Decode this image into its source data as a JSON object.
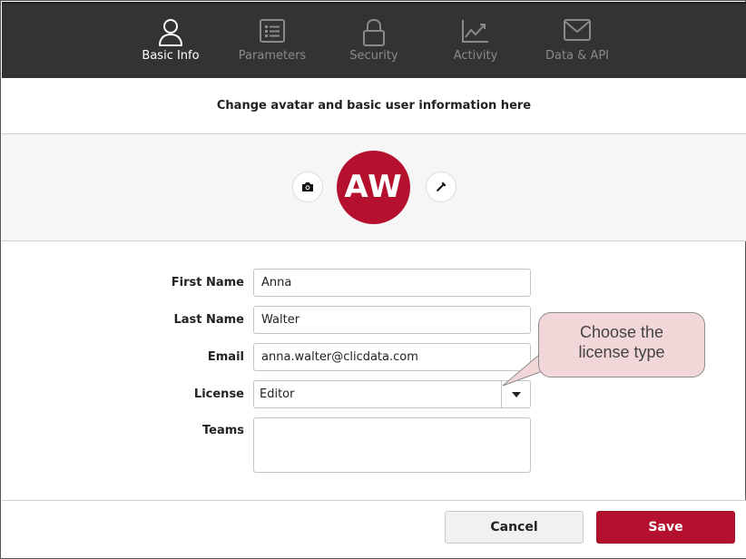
{
  "nav": {
    "tabs": [
      {
        "label": "Basic Info",
        "icon": "user-icon",
        "active": true
      },
      {
        "label": "Parameters",
        "icon": "list-icon",
        "active": false
      },
      {
        "label": "Security",
        "icon": "lock-icon",
        "active": false
      },
      {
        "label": "Activity",
        "icon": "chart-line-icon",
        "active": false
      },
      {
        "label": "Data & API",
        "icon": "envelope-icon",
        "active": false
      }
    ]
  },
  "header": {
    "subtitle": "Change avatar and basic user information here"
  },
  "avatar": {
    "initials": "AW",
    "color": "#b5112f"
  },
  "form": {
    "first_name": {
      "label": "First Name",
      "value": "Anna"
    },
    "last_name": {
      "label": "Last Name",
      "value": "Walter"
    },
    "email": {
      "label": "Email",
      "value": "anna.walter@clicdata.com"
    },
    "license": {
      "label": "License",
      "value": "Editor"
    },
    "teams": {
      "label": "Teams",
      "value": ""
    }
  },
  "callout": {
    "line1": "Choose the",
    "line2": "license type"
  },
  "footer": {
    "cancel_label": "Cancel",
    "save_label": "Save"
  },
  "colors": {
    "nav_bg": "#333333",
    "accent": "#b5112f",
    "callout_bg": "#f2d7d9"
  }
}
